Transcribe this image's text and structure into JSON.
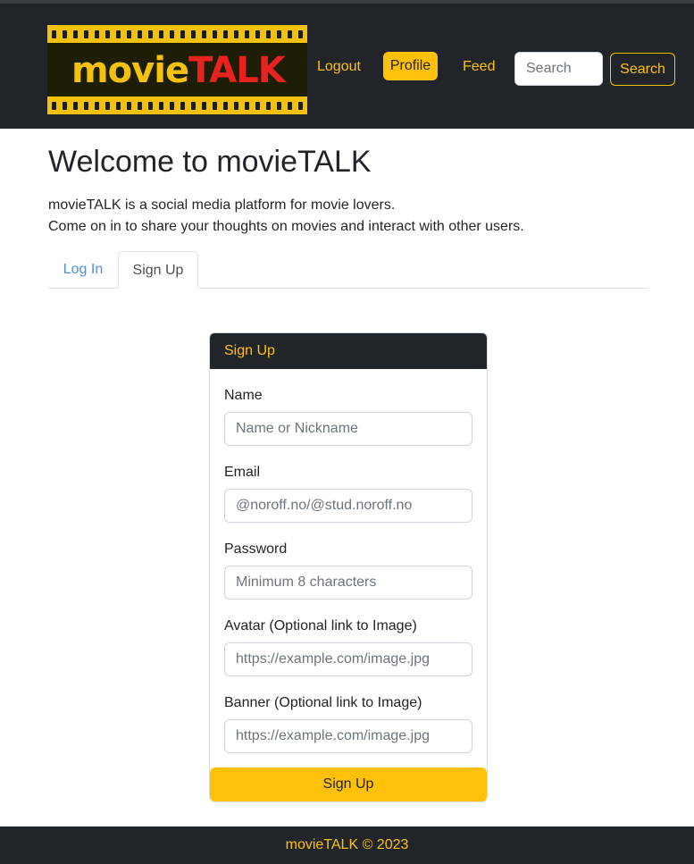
{
  "brand": {
    "part1": "movie",
    "part2": "TALK"
  },
  "nav": {
    "logout": "Logout",
    "profile": "Profile",
    "feed": "Feed",
    "search_placeholder": "Search",
    "search_button": "Search"
  },
  "main": {
    "title": "Welcome to movieTALK",
    "intro_line1": "movieTALK is a social media platform for movie lovers.",
    "intro_line2": "Come on in to share your thoughts on movies and interact with other users.",
    "tabs": [
      {
        "label": "Log In",
        "active": false
      },
      {
        "label": "Sign Up",
        "active": true
      }
    ]
  },
  "form": {
    "header": "Sign Up",
    "fields": [
      {
        "label": "Name",
        "placeholder": "Name or Nickname"
      },
      {
        "label": "Email",
        "placeholder": "@noroff.no/@stud.noroff.no"
      },
      {
        "label": "Password",
        "placeholder": "Minimum 8 characters"
      },
      {
        "label": "Avatar (Optional link to Image)",
        "placeholder": "https://example.com/image.jpg"
      },
      {
        "label": "Banner (Optional link to Image)",
        "placeholder": "https://example.com/image.jpg"
      }
    ],
    "submit": "Sign Up"
  },
  "footer": {
    "text": "movieTALK © 2023"
  },
  "colors": {
    "accent": "#ffc107",
    "dark": "#212529",
    "logo_red": "#e8231f",
    "link_blue": "#4a90d9"
  }
}
